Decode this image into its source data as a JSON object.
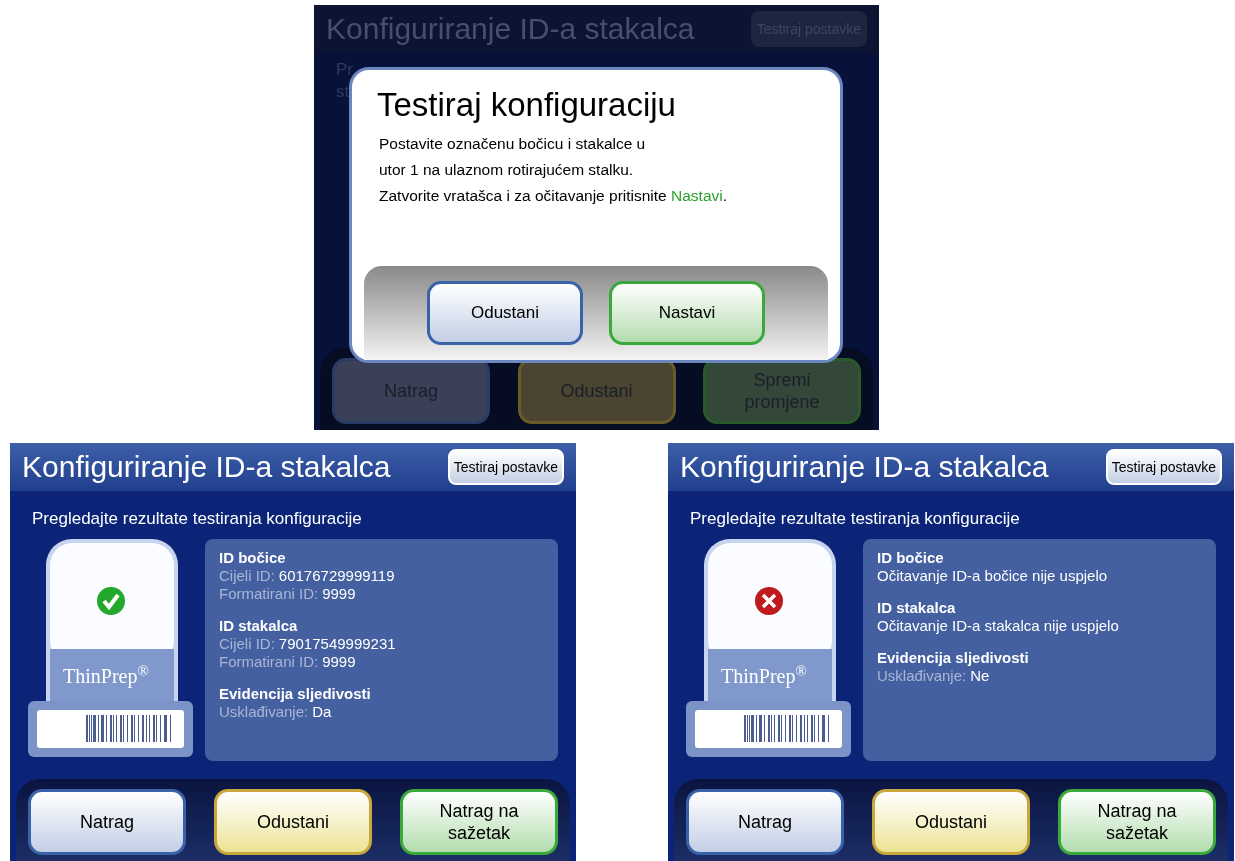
{
  "screens": [
    {
      "kind": "dimmed",
      "title": "Konfiguriranje ID-a stakalca",
      "test_button": "Testiraj postavke",
      "intro_fragments": [
        "Pr",
        "st"
      ],
      "buttons": [
        {
          "label": "Natrag",
          "kind": "back"
        },
        {
          "label": "Odustani",
          "kind": "cancel"
        },
        {
          "label": "Spremi promjene",
          "kind": "save"
        }
      ],
      "dialog": {
        "title": "Testiraj konfiguraciju",
        "lines": [
          {
            "text": "Postavite označenu bočicu i stakalce u"
          },
          {
            "text": "utor 1 na ulaznom rotirajućem stalku."
          },
          {
            "text": "Zatvorite vratašca i za očitavanje pritisnite ",
            "highlight": "Nastavi",
            "after": "."
          }
        ],
        "buttons": [
          {
            "label": "Odustani",
            "kind": "back"
          },
          {
            "label": "Nastavi",
            "kind": "save"
          }
        ]
      }
    },
    {
      "kind": "result",
      "passed": true,
      "title": "Konfiguriranje ID-a stakalca",
      "test_button": "Testiraj postavke",
      "intro": "Pregledajte rezultate testiranja konfiguracije",
      "vial_brand": "ThinPrep$^{®}$",
      "info": [
        {
          "heading": "ID bočice",
          "lines": [
            {
              "label": "Cijeli ID:",
              "value": "60176729999119"
            },
            {
              "label": "Formatirani ID:",
              "value": "9999"
            }
          ]
        },
        {
          "heading": "ID stakalca",
          "lines": [
            {
              "label": "Cijeli ID:",
              "value": "79017549999231"
            },
            {
              "label": "Formatirani ID:",
              "value": "9999"
            }
          ]
        },
        {
          "heading": "Evidencija sljedivosti",
          "lines": [
            {
              "label": "Usklađivanje:",
              "value": "Da"
            }
          ]
        }
      ],
      "buttons": [
        {
          "label": "Natrag",
          "kind": "back"
        },
        {
          "label": "Odustani",
          "kind": "cancel"
        },
        {
          "label": "Natrag na sažetak",
          "kind": "save"
        }
      ]
    },
    {
      "kind": "result",
      "passed": false,
      "title": "Konfiguriranje ID-a stakalca",
      "test_button": "Testiraj postavke",
      "intro": "Pregledajte rezultate testiranja konfiguracije",
      "vial_brand": "ThinPrep$^{®}$",
      "info": [
        {
          "heading": "ID bočice",
          "lines": [
            {
              "value": "Očitavanje ID-a bočice nije uspjelo"
            }
          ]
        },
        {
          "heading": "ID stakalca",
          "lines": [
            {
              "value": "Očitavanje ID-a stakalca nije uspjelo"
            }
          ]
        },
        {
          "heading": "Evidencija sljedivosti",
          "lines": [
            {
              "label": "Usklađivanje:",
              "value": "Ne"
            }
          ]
        }
      ],
      "buttons": [
        {
          "label": "Natrag",
          "kind": "back"
        },
        {
          "label": "Odustani",
          "kind": "cancel"
        },
        {
          "label": "Natrag na sažetak",
          "kind": "save"
        }
      ]
    }
  ]
}
